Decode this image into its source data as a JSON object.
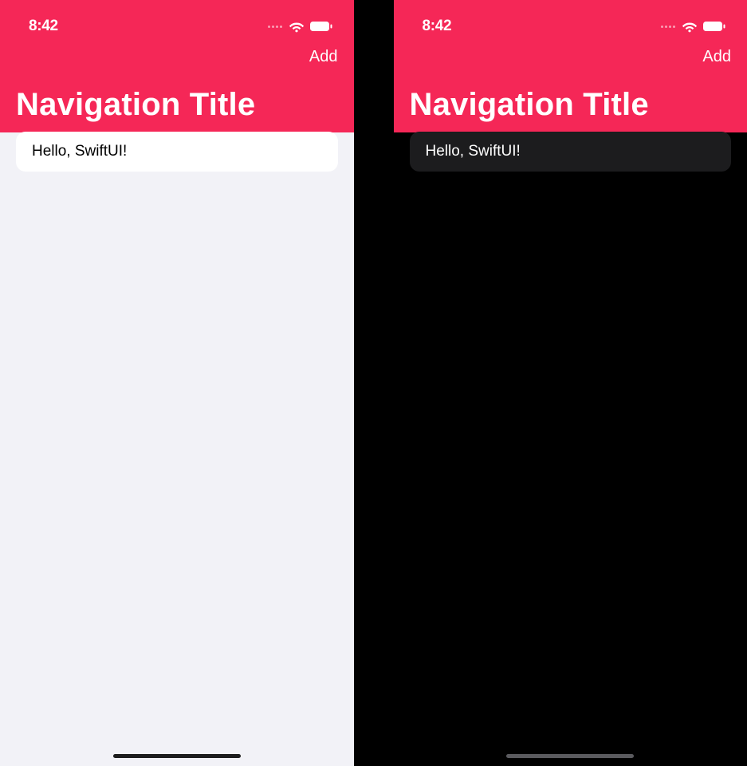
{
  "colors": {
    "accent": "#f52757",
    "light_bg": "#f2f2f7",
    "dark_bg": "#000000",
    "light_row": "#ffffff",
    "dark_row": "#1c1c1e"
  },
  "status": {
    "time": "8:42"
  },
  "nav": {
    "add_label": "Add",
    "title": "Navigation Title"
  },
  "content": {
    "row_text": "Hello, SwiftUI!"
  }
}
